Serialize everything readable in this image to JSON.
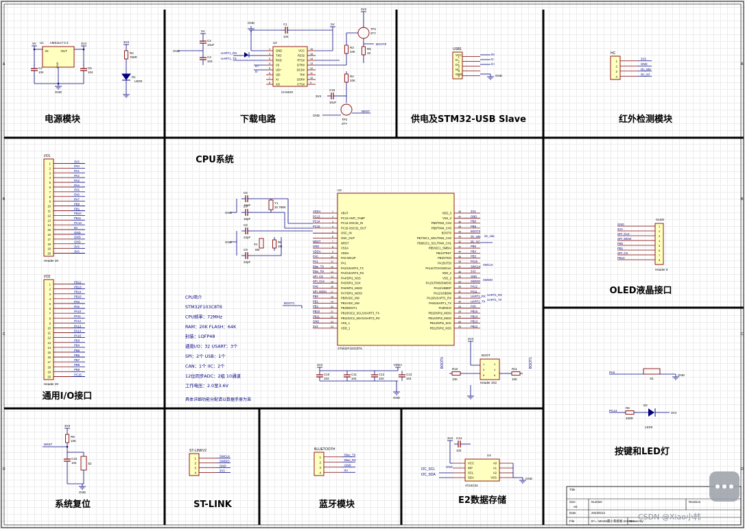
{
  "colors": {
    "wire": "#000080",
    "part": "#800000",
    "text": "#000000",
    "border": "#000000",
    "partfill": "#ffffc0",
    "label": "#000080",
    "accent": "#ff0000",
    "watermark": "#8a8f9a"
  },
  "modules": {
    "power": {
      "title": "电源模块",
      "reg": "AMS1117-3.3",
      "reg_ref": "U1",
      "v_in": "5V",
      "v_out": "3V3",
      "pin_in": "IN",
      "pin_out": "OUT",
      "pin_gnd": "GND",
      "c4": "C4",
      "c4v": "104",
      "c5": "C5",
      "c5v": "104",
      "gnd": "GND",
      "r2": "R2",
      "r2v": "750R",
      "led": "D1",
      "ledv": "LED0",
      "vcc": "3V3"
    },
    "download": {
      "title": "下载电路",
      "chip": "CH340G",
      "ref": "U2",
      "c1": "C1",
      "c1v": "104",
      "c2": "C2",
      "c2v": "10uF",
      "c3": "C3",
      "c3v": "103",
      "v5": "5V",
      "gnd": "GND",
      "uart_tx": "UART1_RX",
      "uart_rx": "UART1_TX",
      "pins_l": [
        "GND",
        "TXD",
        "RXD",
        "V3",
        "UD+",
        "UD-",
        "XI",
        "XO"
      ],
      "pins_r": [
        "VCC",
        "R232",
        "RTS#",
        "DTR#",
        "DCD#",
        "RI#",
        "DSR#",
        "CTS#"
      ],
      "nums_l": [
        "1",
        "2",
        "3",
        "4",
        "5",
        "6",
        "7",
        "8"
      ],
      "nums_r": [
        "16",
        "15",
        "14",
        "13",
        "12",
        "11",
        "10",
        "9"
      ],
      "d1": "D+",
      "d2": "D-",
      "q1": "TP1",
      "q1v": "2TY",
      "q2": "TP2",
      "q2v": "2TY",
      "r3": "R3",
      "r3v": "10K",
      "r5": "R5",
      "r5v": "1K",
      "r4": "R4",
      "r4v": "10K",
      "c16": "C16",
      "c16v": "10uF",
      "boot": "BOOT0",
      "nrst": "NRST",
      "v3v3": "3V3"
    },
    "usb": {
      "title": "供电及STM32-USB Slave",
      "ref": "USB1",
      "pins": [
        "VCC",
        "D-",
        "D+",
        "NC",
        "GND"
      ],
      "nets": [
        "5V",
        "D-",
        "D+",
        "",
        ""
      ],
      "gnd": "GND"
    },
    "ir": {
      "title": "红外检测模块",
      "ref": "HC",
      "pins": [
        "1",
        "2",
        "3",
        "4"
      ],
      "nets": [
        "3V3",
        "GND",
        "i2c_sda",
        "i2c_scl"
      ]
    },
    "cpu": {
      "title": "CPU系统",
      "chip": "STM32F103C8T6",
      "ref": "U3",
      "left_pins": [
        "VBAT",
        "PC13-ANTI_TAMP",
        "PC14-OSC32_IN",
        "PC15-OSC32_OUT",
        "OSC_IN",
        "OSC_OUT",
        "NRST",
        "VSSA",
        "VDDA",
        "PA0-WKUP",
        "PA1",
        "PA2/USART2_TX",
        "PA3/USART2_RX",
        "PA4/SPI1_NSS",
        "PA5/SPI1_SCK",
        "PA6/SPI1_MISO",
        "PA7/SPI1_MOSI",
        "PB0/ADC_IN8",
        "PB1/ADC_IN9",
        "PB2/BOOT1",
        "PB10/I2C2_SCL/USART3_TX",
        "PB11/I2C2_SDA/USART3_RX",
        "VSS_1",
        "VDD_1"
      ],
      "left_nets": [
        "VDDA",
        "PC13",
        "PC14",
        "PC15",
        "",
        "",
        "NRST",
        "GND",
        "VDDA",
        "PA0",
        "PA1",
        "Blue_TX",
        "Blue_RX",
        "SPI_CS",
        "SPI_CLK",
        "PA6",
        "SPI_MOSI",
        "PB0",
        "PB1",
        "PB2",
        "PB10",
        "PB11",
        "GND",
        "3V3"
      ],
      "right_pins": [
        "VDD_3",
        "VSS_3",
        "PB9/TIM4_CH4",
        "PB8/TIM4_CH3",
        "BOOT0",
        "PB7/I2C1_SDA/TIM4_CH2",
        "PB6/I2C1_SCL/TIM4_CH1",
        "PB5/I2C1_SMBAI",
        "PB4/JTRST",
        "PB3/JTDO",
        "PA15/JTDI",
        "PA14/JTCK/SWCLK",
        "VDD_2",
        "VSS_2",
        "PA13/JTMS/SWDIO",
        "PA12/USBDP",
        "PA11/USBDM",
        "PA10/USART1_RX",
        "PA9/USART1_TX",
        "PA8/MCO",
        "PB15/SPI2_MOSI",
        "PB14/SPI2_MISO",
        "PB13/SPI2_SCK",
        "PB12/SPI2_NSS"
      ],
      "right_nets": [
        "3V3",
        "GND",
        "PB9",
        "PB8",
        "BOOT0",
        "i2c_sda",
        "i2c_scl",
        "PB5",
        "PB4",
        "PB3",
        "PA15",
        "SWCLK",
        "3V3",
        "GND",
        "SWDIO",
        "PA12",
        "PA11",
        "UART1_RX",
        "UART1_TX",
        "PA8",
        "PB15",
        "PB14",
        "PB13",
        "PB12"
      ],
      "c6": "C6",
      "c6v": "15pF",
      "c7": "C7",
      "c7v": "15pF",
      "y1": "Y1",
      "y1v": "32.768K",
      "c8": "C8",
      "c8v": "22pF",
      "c9": "C9",
      "c9v": "22pF",
      "x1": "X1",
      "x1v": "8M",
      "r6": "R6",
      "r6v": "1M",
      "gnd": "GND",
      "boot1": "BOOT1",
      "caps": [
        "C10",
        "C11",
        "C12",
        "C13"
      ],
      "capv": "104",
      "vdda": "VDDA",
      "v3v3": "3V3",
      "info_title": "CPU简介",
      "info_lines": [
        "STM32F103C8T6",
        "CPU频率：72MHz",
        "RAM：20K    FLASH：64K",
        "封装：LQFP48",
        "通用I/O：32       USART：3个",
        "SPI：2个               USB：1个",
        "CAN：1个               IIC：2个",
        "12位同步ADC：2组 10通道",
        "工作电压：2.0至3.6V"
      ],
      "info_note": "具体详细功能分配请以数据手册为准",
      "boot_ref": "BOOT",
      "boot_hdr": "Header 3X2",
      "r10": "R10",
      "r10v": "10K",
      "r11": "R11",
      "r11v": "10K",
      "boot0": "BOOT0",
      "boot1n": "BOOT1"
    },
    "io": {
      "title": "通用I/O接口",
      "h1": "I/O1",
      "h1_type": "Header 20",
      "h1_nets": [
        "3V3",
        "PA0",
        "PA1",
        "PA2",
        "PA3",
        "PA4",
        "PA5",
        "PA6",
        "PA7",
        "PB0",
        "PB1",
        "PB10",
        "PB11",
        "PC13",
        "5V",
        "GND",
        "GND",
        "GND",
        "3V3",
        "3V3"
      ],
      "h2": "I/O2",
      "h2_type": "Header 20",
      "h2_nets": [
        "PB12",
        "PB13",
        "PB14",
        "PB15",
        "PA8",
        "PA9",
        "PA10",
        "PA11",
        "PA12",
        "PA13",
        "PA14",
        "PA15",
        "PB3",
        "PB4",
        "PB5",
        "PB6",
        "PB7",
        "PB8",
        "PB9",
        "PC15"
      ]
    },
    "oled": {
      "title": "OLED液晶接口",
      "ref": "OLED",
      "type": "Header 8",
      "nets": [
        "GND",
        "3V3",
        "SPI_CLK",
        "SPI_MOSI",
        "PB0",
        "PB1",
        "SPI_CS",
        "PB12"
      ]
    },
    "keys": {
      "title": "按键和LED灯",
      "s1": "S1",
      "key_net": "PA0",
      "gnd": "GND",
      "r8": "R8",
      "r8v": "330R",
      "d2": "D2",
      "d2v": "LED0",
      "led_net": "PC13",
      "vcc": "3V3"
    },
    "reset": {
      "title": "系统复位",
      "r9": "R9",
      "r9v": "10K",
      "c15": "C15",
      "c15v": "104",
      "s2": "S2",
      "net": "NRST",
      "vcc": "3V3",
      "gnd": "GND"
    },
    "stlink": {
      "title": "ST-LINK",
      "ref": "ST-LINKV2",
      "nets": [
        "SWCLK",
        "SWDIO",
        "GND",
        "3V3"
      ]
    },
    "bt": {
      "title": "蓝牙模块",
      "ref": "BLUETOOTH",
      "nets": [
        "Blue_TX",
        "Blue_RX",
        "GND",
        "5V"
      ]
    },
    "e2": {
      "title": "E2数据存储",
      "chip": "AT24C04",
      "ref": "U4",
      "c14": "C14",
      "c14v": "104",
      "pins_l": [
        "VCC",
        "WP",
        "SCL",
        "SDA"
      ],
      "pins_r": [
        "A0",
        "A1",
        "A2",
        "VSS"
      ],
      "nets_l": [
        "3V3",
        "GND",
        "I2C_SCL",
        "I2C_SDA"
      ],
      "gnd": "GND",
      "v3v3": "3V3"
    }
  },
  "title_block": {
    "title_lbl": "Title",
    "size_lbl": "Size",
    "size": "A5",
    "number_lbl": "Number",
    "rev_lbl": "Revision",
    "date_lbl": "Date",
    "date": "2022/5/12",
    "file_lbl": "File",
    "file": "D:\\...\\stm32最小系统板.SchDoc",
    "drawn_lbl": "Drawn By:"
  },
  "frame": {
    "row_labels": [
      "A",
      "B",
      "C",
      "D"
    ],
    "col_labels": []
  },
  "watermark": "CSDN @Xiao小韩"
}
